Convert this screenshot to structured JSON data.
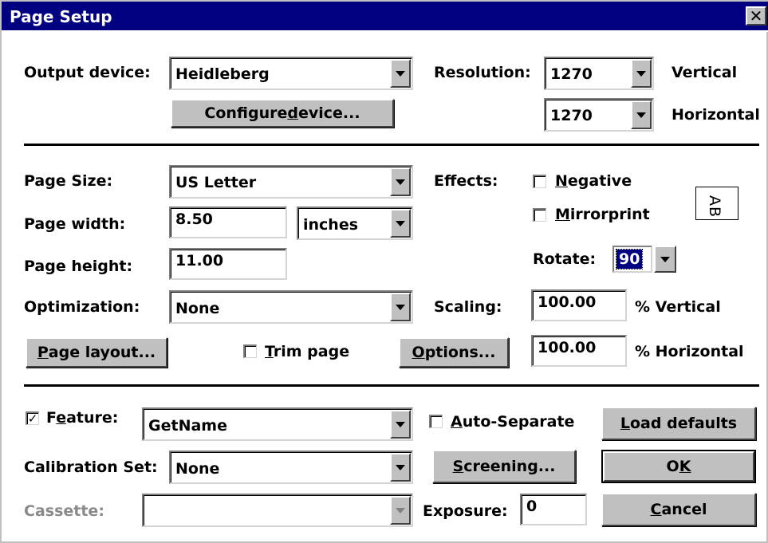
{
  "window": {
    "title": "Page Setup",
    "close_glyph": "✕"
  },
  "output": {
    "device_label": "Output device:",
    "device_value": "Heidleberg",
    "configure_pre": "Configure ",
    "configure_u": "d",
    "configure_post": "evice...",
    "resolution_label": "Resolution:",
    "res_vertical_value": "1270",
    "res_vertical_label": "Vertical",
    "res_horizontal_value": "1270",
    "res_horizontal_label": "Horizontal"
  },
  "page": {
    "size_label": "Page Size:",
    "size_value": "US Letter",
    "width_label": "Page width:",
    "width_value": "8.50",
    "units_value": "inches",
    "height_label": "Page height:",
    "height_value": "11.00",
    "optimization_label": "Optimization:",
    "optimization_value": "None",
    "layout_u": "P",
    "layout_post": "age layout...",
    "trim_u": "T",
    "trim_post": "rim page",
    "options_u": "O",
    "options_post": "ptions..."
  },
  "effects": {
    "label": "Effects:",
    "negative_u": "N",
    "negative_post": "egative",
    "mirror_u": "M",
    "mirror_post": "irrorprint",
    "preview_text": "AB",
    "rotate_label": "Rotate:",
    "rotate_value": "90",
    "scaling_label": "Scaling:",
    "scale_vertical_value": "100.00",
    "scale_vertical_label": "% Vertical",
    "scale_horizontal_value": "100.00",
    "scale_horizontal_label": "% Horizontal"
  },
  "bottom": {
    "feature_pre": "F",
    "feature_u": "e",
    "feature_post": "ature:",
    "feature_checked": "✓",
    "feature_value": "GetName",
    "autosep_u": "A",
    "autosep_post": "uto-Separate",
    "load_u": "L",
    "load_post": "oad defaults",
    "calibration_label": "Calibration Set:",
    "calibration_value": "None",
    "screening_u": "S",
    "screening_post": "creening...",
    "ok_pre": "O",
    "ok_u": "K",
    "cassette_label": "Cassette:",
    "cassette_value": "",
    "exposure_label": "Exposure:",
    "exposure_value": "0",
    "cancel_u": "C",
    "cancel_post": "ancel"
  }
}
